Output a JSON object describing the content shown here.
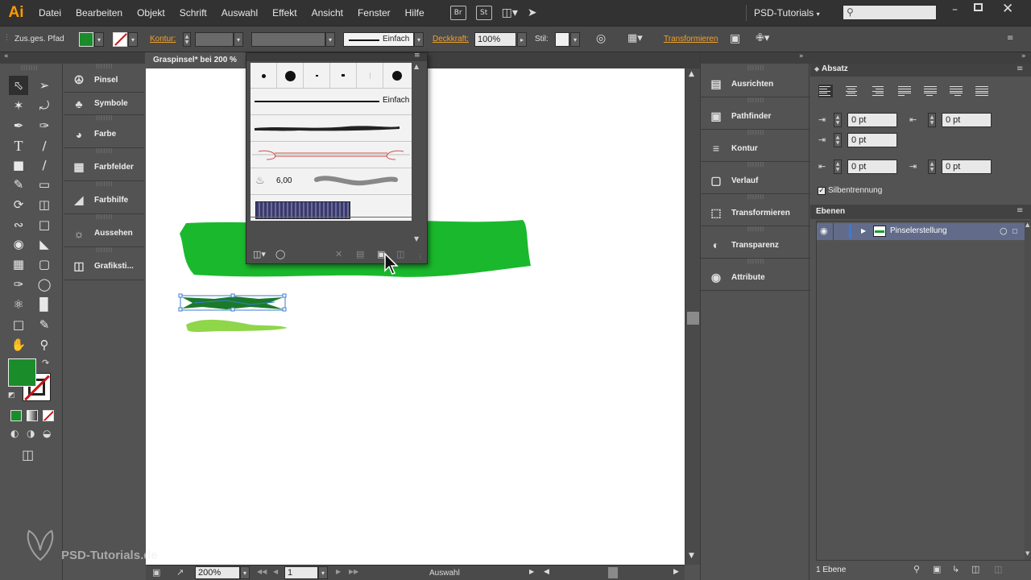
{
  "menubar": {
    "app_logo": "Ai",
    "items": [
      "Datei",
      "Bearbeiten",
      "Objekt",
      "Schrift",
      "Auswahl",
      "Effekt",
      "Ansicht",
      "Fenster",
      "Hilfe"
    ],
    "br_label": "Br",
    "st_label": "St",
    "workspace": "PSD-Tutorials",
    "search_placeholder": ""
  },
  "controlbar": {
    "selection_type": "Zus.ges. Pfad",
    "fill_color": "#1a8c2a",
    "kontur_label": "Kontur:",
    "stroke_style": "Einfach",
    "deckkraft_label": "Deckkraft:",
    "deckkraft_value": "100%",
    "stil_label": "Stil:",
    "transformieren_label": "Transformieren"
  },
  "document": {
    "tab_title": "Graspinsel* bei 200 %"
  },
  "left_collapsed_panels": [
    {
      "label": "Pinsel",
      "icon": "brush-icon"
    },
    {
      "label": "Symbole",
      "icon": "club-icon"
    },
    {
      "label": "Farbe",
      "icon": "palette-icon"
    },
    {
      "label": "Farbfelder",
      "icon": "grid-icon"
    },
    {
      "label": "Farbhilfe",
      "icon": "color-guide-icon"
    },
    {
      "label": "Aussehen",
      "icon": "sun-icon"
    },
    {
      "label": "Grafiksti...",
      "icon": "graphic-style-icon"
    }
  ],
  "right_collapsed_panels": [
    {
      "label": "Ausrichten",
      "icon": "align-icon"
    },
    {
      "label": "Pathfinder",
      "icon": "pathfinder-icon"
    },
    {
      "label": "Kontur",
      "icon": "stroke-icon"
    },
    {
      "label": "Verlauf",
      "icon": "gradient-icon"
    },
    {
      "label": "Transformieren",
      "icon": "transform-icon"
    },
    {
      "label": "Transparenz",
      "icon": "transparency-icon"
    },
    {
      "label": "Attribute",
      "icon": "attributes-icon"
    }
  ],
  "brushes_panel": {
    "einfach_label": "Einfach",
    "size_label": "6,00"
  },
  "absatz_panel": {
    "title": "Absatz",
    "indent_left": "0 pt",
    "indent_right": "0 pt",
    "first_line": "0 pt",
    "space_before": "0 pt",
    "space_after": "0 pt",
    "hyphenation_label": "Silbentrennung"
  },
  "ebenen_panel": {
    "title": "Ebenen",
    "layer_name": "Pinselerstellung",
    "footer_count": "1 Ebene"
  },
  "statusbar": {
    "zoom": "200%",
    "page": "1",
    "mode": "Auswahl"
  },
  "tools": {
    "fill_color": "#1a8c2a",
    "stroke_color": "#ffffff"
  },
  "watermark": "PSD-Tutorials.de"
}
